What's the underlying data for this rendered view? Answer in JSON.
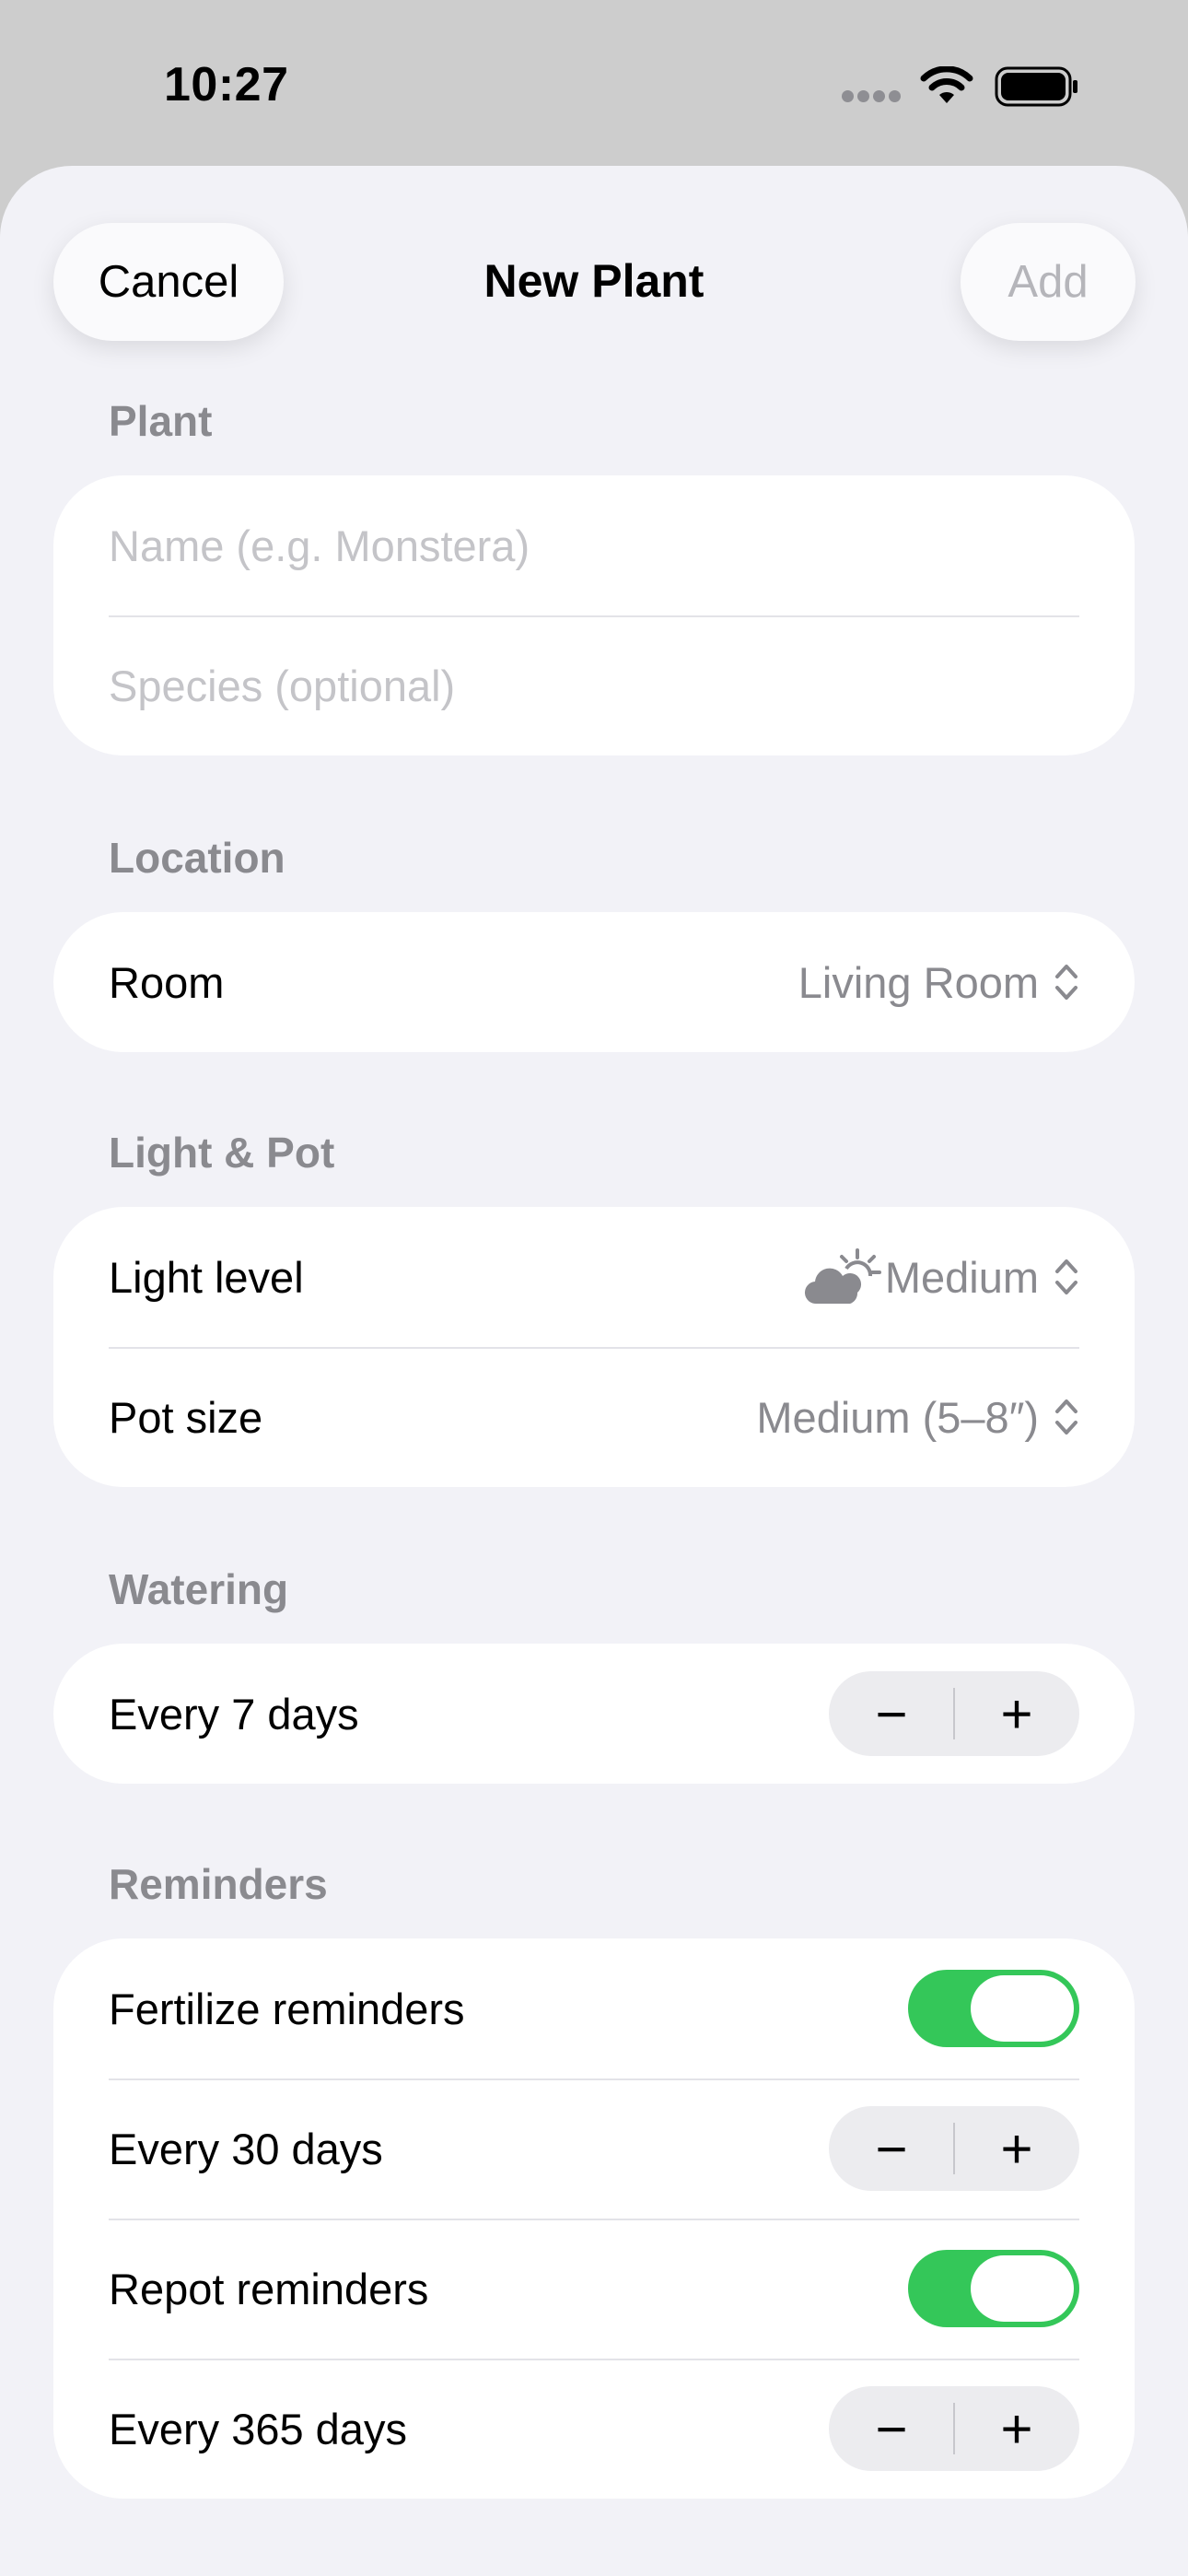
{
  "status_bar": {
    "time": "10:27"
  },
  "nav": {
    "cancel_label": "Cancel",
    "title": "New Plant",
    "add_label": "Add"
  },
  "plant": {
    "header": "Plant",
    "name_placeholder": "Name (e.g. Monstera)",
    "species_placeholder": "Species (optional)"
  },
  "location": {
    "header": "Location",
    "room_label": "Room",
    "room_value": "Living Room"
  },
  "light_pot": {
    "header": "Light & Pot",
    "light_label": "Light level",
    "light_value": "Medium",
    "light_icon": "cloud-sun-icon",
    "pot_label": "Pot size",
    "pot_value": "Medium (5–8″)"
  },
  "watering": {
    "header": "Watering",
    "interval_label": "Every 7 days",
    "minus": "−",
    "plus": "+"
  },
  "reminders": {
    "header": "Reminders",
    "fertilize_label": "Fertilize reminders",
    "fertilize_on": true,
    "fertilize_interval": "Every 30 days",
    "repot_label": "Repot reminders",
    "repot_on": true,
    "repot_interval": "Every 365 days",
    "minus": "−",
    "plus": "+"
  },
  "colors": {
    "accent_green": "#34c759",
    "background": "#f2f2f7",
    "secondary_text": "#8a8a8f"
  }
}
